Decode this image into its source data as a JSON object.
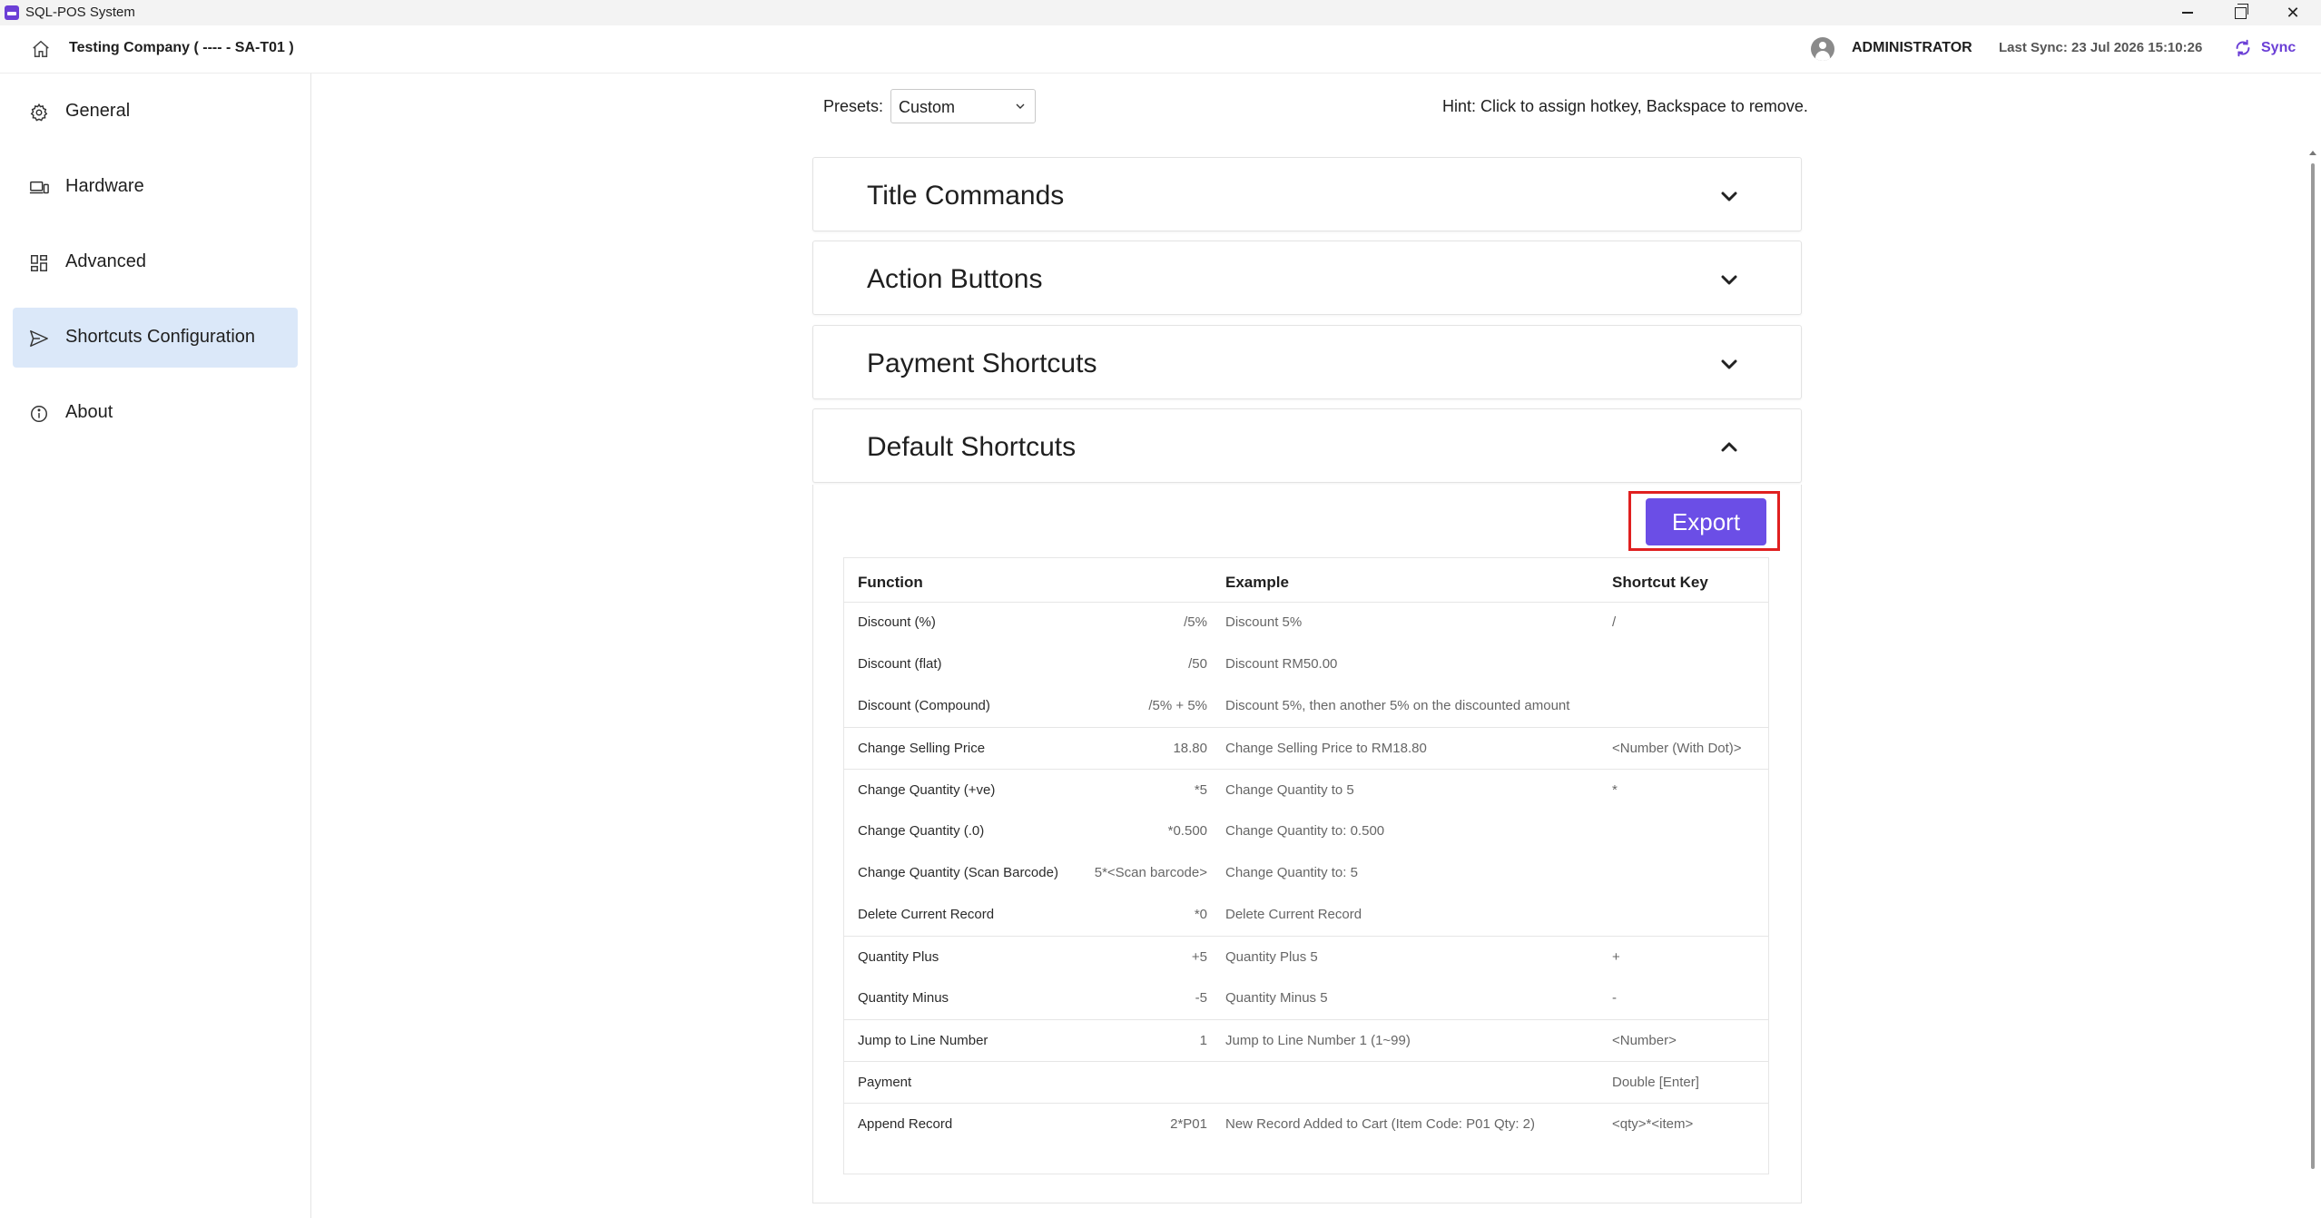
{
  "app": {
    "title": "SQL-POS System",
    "accent": "#6b4ee6"
  },
  "header": {
    "company": "Testing Company ( ---- - SA-T01 )",
    "user": "ADMINISTRATOR",
    "last_sync": "Last Sync: 23 Jul 2026 15:10:26",
    "sync_label": "Sync"
  },
  "sidebar": {
    "items": [
      {
        "label": "General",
        "icon": "gear-icon",
        "active": false
      },
      {
        "label": "Hardware",
        "icon": "devices-icon",
        "active": false
      },
      {
        "label": "Advanced",
        "icon": "grid-icon",
        "active": false
      },
      {
        "label": "Shortcuts Configuration",
        "icon": "send-icon",
        "active": true
      },
      {
        "label": "About",
        "icon": "info-icon",
        "active": false
      }
    ]
  },
  "main": {
    "presets_label": "Presets:",
    "presets_value": "Custom",
    "hint": "Hint: Click to assign hotkey, Backspace to remove.",
    "panels": [
      {
        "title": "Title Commands",
        "expanded": false
      },
      {
        "title": "Action Buttons",
        "expanded": false
      },
      {
        "title": "Payment Shortcuts",
        "expanded": false
      },
      {
        "title": "Default Shortcuts",
        "expanded": true
      }
    ],
    "export_label": "Export",
    "table": {
      "headers": {
        "function": "Function",
        "example": "Example",
        "key": "Shortcut Key"
      },
      "rows": [
        {
          "function": "Discount (%)",
          "code": "/5%",
          "example": "Discount 5%",
          "key": "/"
        },
        {
          "function": "Discount (flat)",
          "code": "/50",
          "example": "Discount RM50.00",
          "key": ""
        },
        {
          "function": "Discount (Compound)",
          "code": "/5% + 5%",
          "example": "Discount 5%, then another 5% on the discounted amount",
          "key": ""
        },
        {
          "function": "Change Selling Price",
          "code": "18.80",
          "example": "Change Selling Price to RM18.80",
          "key": "<Number (With Dot)>"
        },
        {
          "function": "Change Quantity (+ve)",
          "code": "*5",
          "example": "Change Quantity to 5",
          "key": "*"
        },
        {
          "function": "Change Quantity (.0)",
          "code": "*0.500",
          "example": "Change Quantity to: 0.500",
          "key": ""
        },
        {
          "function": "Change Quantity (Scan Barcode)",
          "code": "5*<Scan barcode>",
          "example": "Change Quantity to: 5",
          "key": ""
        },
        {
          "function": "Delete Current Record",
          "code": "*0",
          "example": "Delete Current Record",
          "key": ""
        },
        {
          "function": "Quantity Plus",
          "code": "+5",
          "example": "Quantity Plus 5",
          "key": "+"
        },
        {
          "function": "Quantity Minus",
          "code": "-5",
          "example": "Quantity Minus 5",
          "key": "-"
        },
        {
          "function": "Jump to Line Number",
          "code": "1",
          "example": "Jump to Line Number 1 (1~99)",
          "key": "<Number>"
        },
        {
          "function": "Payment",
          "code": "",
          "example": "",
          "key": "Double [Enter]"
        },
        {
          "function": "Append Record",
          "code": "2*P01",
          "example": "New Record Added to Cart (Item Code: P01 Qty: 2)",
          "key": "<qty>*<item>"
        }
      ]
    }
  }
}
